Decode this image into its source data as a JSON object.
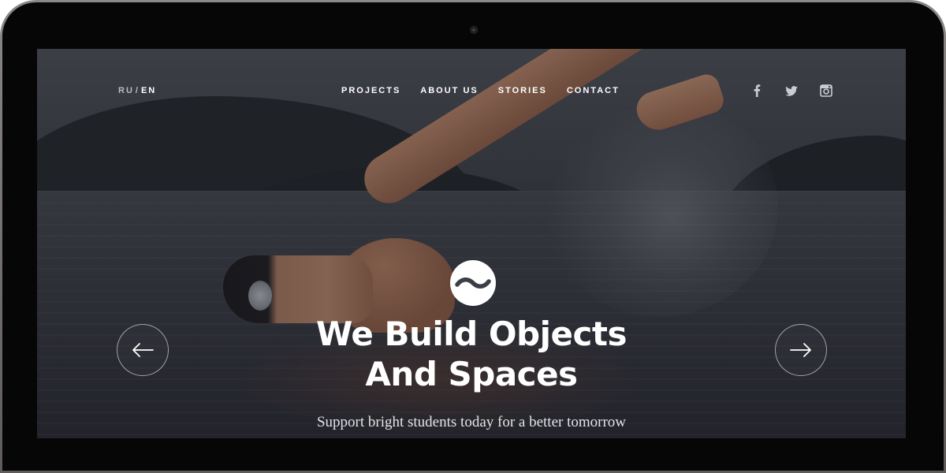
{
  "header": {
    "languages": {
      "inactive": "RU",
      "separator": "/",
      "active": "EN"
    },
    "nav": [
      {
        "label": "PROJECTS"
      },
      {
        "label": "ABOUT US"
      },
      {
        "label": "STORIES"
      },
      {
        "label": "CONTACT"
      }
    ],
    "social": [
      {
        "icon": "facebook-icon"
      },
      {
        "icon": "twitter-icon"
      },
      {
        "icon": "instagram-icon"
      }
    ]
  },
  "hero": {
    "logo_icon": "wave-logo-icon",
    "headline_line1": "We Build Objects",
    "headline_line2": "And Spaces",
    "subtitle": "Support bright students today for a better tomorrow",
    "prev_icon": "arrow-left-icon",
    "next_icon": "arrow-right-icon"
  },
  "colors": {
    "text": "#ffffff",
    "muted": "#b9bcc2",
    "bezel": "#060606"
  }
}
